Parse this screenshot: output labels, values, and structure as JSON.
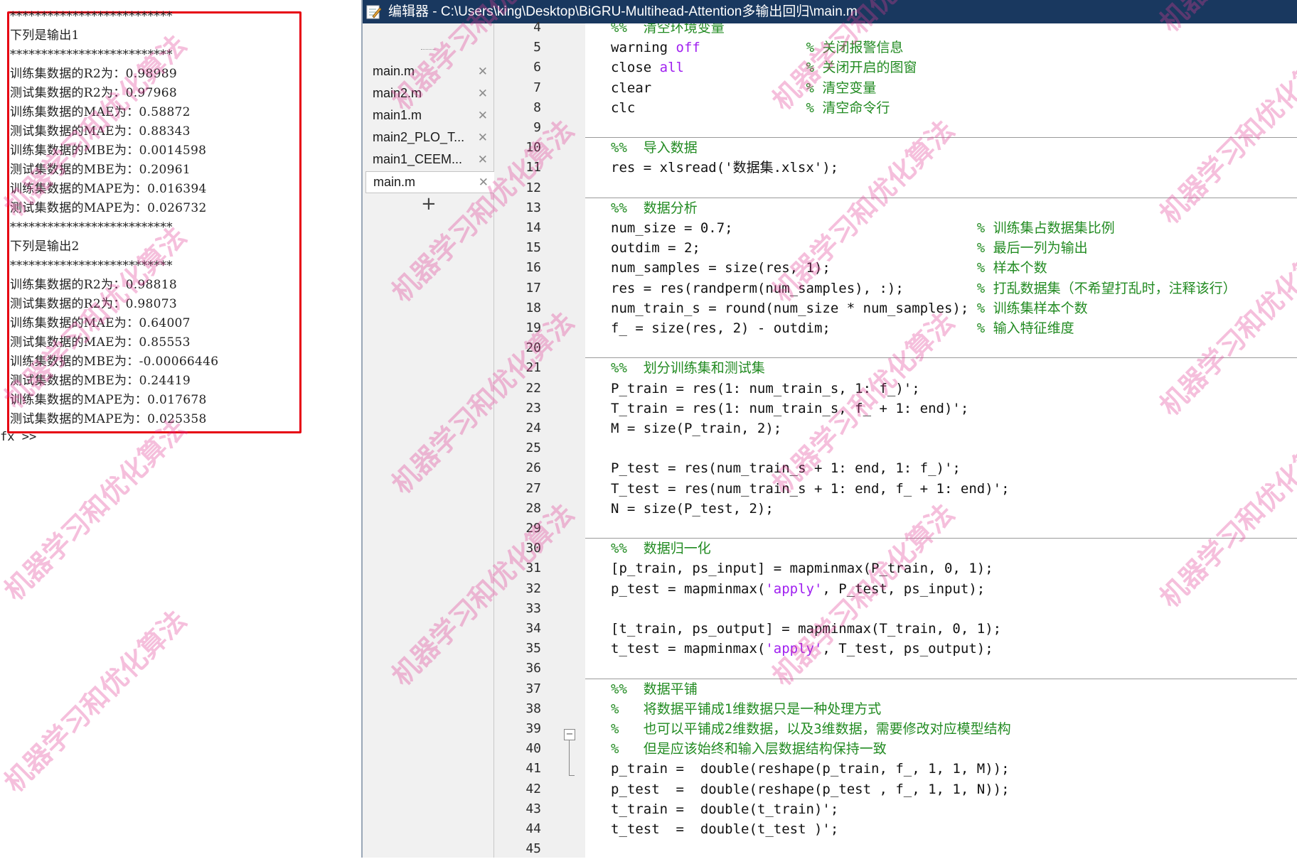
{
  "command_window": {
    "lines": [
      "**************************",
      "下列是输出1",
      "**************************",
      "训练集数据的R2为：0.98989",
      "测试集数据的R2为：0.97968",
      "训练集数据的MAE为：0.58872",
      "测试集数据的MAE为：0.88343",
      "训练集数据的MBE为：0.0014598",
      "测试集数据的MBE为：0.20961",
      "训练集数据的MAPE为：0.016394",
      "测试集数据的MAPE为：0.026732",
      "**************************",
      "下列是输出2",
      "**************************",
      "训练集数据的R2为：0.98818",
      "测试集数据的R2为：0.98073",
      "训练集数据的MAE为：0.64007",
      "测试集数据的MAE为：0.85553",
      "训练集数据的MBE为：-0.00066446",
      "测试集数据的MBE为：0.24419",
      "训练集数据的MAPE为：0.017678",
      "测试集数据的MAPE为：0.025358"
    ],
    "prompt": "fx >>"
  },
  "editor": {
    "title": "编辑器 - C:\\Users\\king\\Desktop\\BiGRU-Multihead-Attention多输出回归\\main.m",
    "tabs": [
      {
        "label": "main.m",
        "active": false
      },
      {
        "label": "main2.m",
        "active": false
      },
      {
        "label": "main1.m",
        "active": false
      },
      {
        "label": "main2_PLO_T...",
        "active": false
      },
      {
        "label": "main1_CEEM...",
        "active": false
      },
      {
        "label": "main.m",
        "active": true
      }
    ],
    "close_glyph": "✕",
    "add_tab": "+",
    "fold_glyph": "−",
    "lines": [
      {
        "n": "4",
        "code": "%%  清空环境变量",
        "cls": "cm"
      },
      {
        "n": "5",
        "code": "warning off             % 关闭报警信息"
      },
      {
        "n": "6",
        "code": "close all               % 关闭开启的图窗"
      },
      {
        "n": "7",
        "code": "clear                   % 清空变量"
      },
      {
        "n": "8",
        "code": "clc                     % 清空命令行"
      },
      {
        "n": "9",
        "code": ""
      },
      {
        "n": "10",
        "code": "%%  导入数据",
        "cls": "cm"
      },
      {
        "n": "11",
        "code": "res = xlsread('数据集.xlsx');"
      },
      {
        "n": "12",
        "code": ""
      },
      {
        "n": "13",
        "code": "%%  数据分析",
        "cls": "cm"
      },
      {
        "n": "14",
        "code": "num_size = 0.7;                              % 训练集占数据集比例"
      },
      {
        "n": "15",
        "code": "outdim = 2;                                  % 最后一列为输出"
      },
      {
        "n": "16",
        "code": "num_samples = size(res, 1);                  % 样本个数"
      },
      {
        "n": "17",
        "code": "res = res(randperm(num_samples), :);         % 打乱数据集（不希望打乱时，注释该行）"
      },
      {
        "n": "18",
        "code": "num_train_s = round(num_size * num_samples); % 训练集样本个数"
      },
      {
        "n": "19",
        "code": "f_ = size(res, 2) - outdim;                  % 输入特征维度"
      },
      {
        "n": "20",
        "code": ""
      },
      {
        "n": "21",
        "code": "%%  划分训练集和测试集",
        "cls": "cm"
      },
      {
        "n": "22",
        "code": "P_train = res(1: num_train_s, 1: f_)';"
      },
      {
        "n": "23",
        "code": "T_train = res(1: num_train_s, f_ + 1: end)';"
      },
      {
        "n": "24",
        "code": "M = size(P_train, 2);"
      },
      {
        "n": "25",
        "code": ""
      },
      {
        "n": "26",
        "code": "P_test = res(num_train_s + 1: end, 1: f_)';"
      },
      {
        "n": "27",
        "code": "T_test = res(num_train_s + 1: end, f_ + 1: end)';"
      },
      {
        "n": "28",
        "code": "N = size(P_test, 2);"
      },
      {
        "n": "29",
        "code": ""
      },
      {
        "n": "30",
        "code": "%%  数据归一化",
        "cls": "cm"
      },
      {
        "n": "31",
        "code": "[p_train, ps_input] = mapminmax(P_train, 0, 1);"
      },
      {
        "n": "32",
        "code": "p_test = mapminmax('apply', P_test, ps_input);"
      },
      {
        "n": "33",
        "code": ""
      },
      {
        "n": "34",
        "code": "[t_train, ps_output] = mapminmax(T_train, 0, 1);"
      },
      {
        "n": "35",
        "code": "t_test = mapminmax('apply', T_test, ps_output);"
      },
      {
        "n": "36",
        "code": ""
      },
      {
        "n": "37",
        "code": "%%  数据平铺",
        "cls": "cm"
      },
      {
        "n": "38",
        "code": "%   将数据平铺成1维数据只是一种处理方式",
        "cls": "cm"
      },
      {
        "n": "39",
        "code": "%   也可以平铺成2维数据，以及3维数据，需要修改对应模型结构",
        "cls": "cm"
      },
      {
        "n": "40",
        "code": "%   但是应该始终和输入层数据结构保持一致",
        "cls": "cm"
      },
      {
        "n": "41",
        "code": "p_train =  double(reshape(p_train, f_, 1, 1, M));"
      },
      {
        "n": "42",
        "code": "p_test  =  double(reshape(p_test , f_, 1, 1, N));"
      },
      {
        "n": "43",
        "code": "t_train =  double(t_train)';"
      },
      {
        "n": "44",
        "code": "t_test  =  double(t_test )';"
      },
      {
        "n": "45",
        "code": ""
      }
    ]
  },
  "watermark": "机器学习和优化算法",
  "colors": {
    "titlebar": "#19385f",
    "comment": "#228b22",
    "string": "#a020f0",
    "highlight_box": "#e60012"
  }
}
